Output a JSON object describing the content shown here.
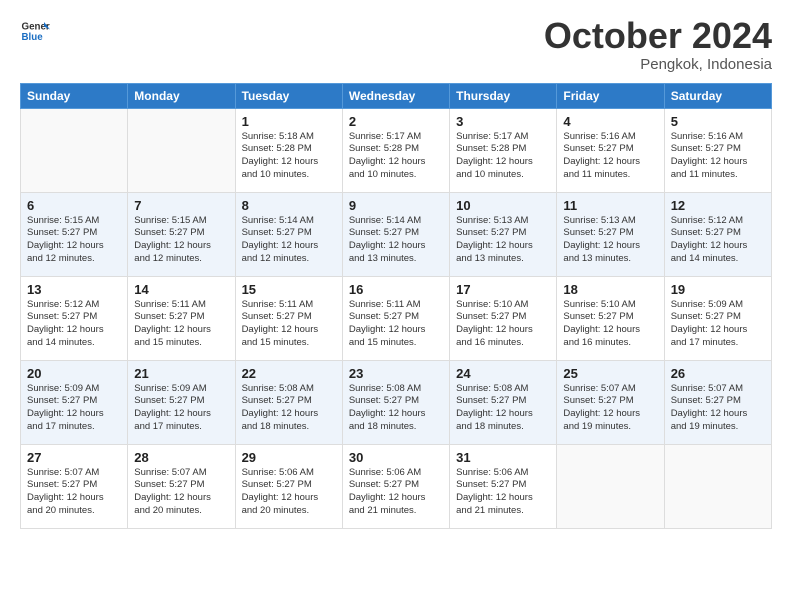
{
  "header": {
    "logo_line1": "General",
    "logo_line2": "Blue",
    "month": "October 2024",
    "location": "Pengkok, Indonesia"
  },
  "days_of_week": [
    "Sunday",
    "Monday",
    "Tuesday",
    "Wednesday",
    "Thursday",
    "Friday",
    "Saturday"
  ],
  "weeks": [
    [
      {
        "day": null,
        "info": null
      },
      {
        "day": null,
        "info": null
      },
      {
        "day": "1",
        "info": "Sunrise: 5:18 AM\nSunset: 5:28 PM\nDaylight: 12 hours\nand 10 minutes."
      },
      {
        "day": "2",
        "info": "Sunrise: 5:17 AM\nSunset: 5:28 PM\nDaylight: 12 hours\nand 10 minutes."
      },
      {
        "day": "3",
        "info": "Sunrise: 5:17 AM\nSunset: 5:28 PM\nDaylight: 12 hours\nand 10 minutes."
      },
      {
        "day": "4",
        "info": "Sunrise: 5:16 AM\nSunset: 5:27 PM\nDaylight: 12 hours\nand 11 minutes."
      },
      {
        "day": "5",
        "info": "Sunrise: 5:16 AM\nSunset: 5:27 PM\nDaylight: 12 hours\nand 11 minutes."
      }
    ],
    [
      {
        "day": "6",
        "info": "Sunrise: 5:15 AM\nSunset: 5:27 PM\nDaylight: 12 hours\nand 12 minutes."
      },
      {
        "day": "7",
        "info": "Sunrise: 5:15 AM\nSunset: 5:27 PM\nDaylight: 12 hours\nand 12 minutes."
      },
      {
        "day": "8",
        "info": "Sunrise: 5:14 AM\nSunset: 5:27 PM\nDaylight: 12 hours\nand 12 minutes."
      },
      {
        "day": "9",
        "info": "Sunrise: 5:14 AM\nSunset: 5:27 PM\nDaylight: 12 hours\nand 13 minutes."
      },
      {
        "day": "10",
        "info": "Sunrise: 5:13 AM\nSunset: 5:27 PM\nDaylight: 12 hours\nand 13 minutes."
      },
      {
        "day": "11",
        "info": "Sunrise: 5:13 AM\nSunset: 5:27 PM\nDaylight: 12 hours\nand 13 minutes."
      },
      {
        "day": "12",
        "info": "Sunrise: 5:12 AM\nSunset: 5:27 PM\nDaylight: 12 hours\nand 14 minutes."
      }
    ],
    [
      {
        "day": "13",
        "info": "Sunrise: 5:12 AM\nSunset: 5:27 PM\nDaylight: 12 hours\nand 14 minutes."
      },
      {
        "day": "14",
        "info": "Sunrise: 5:11 AM\nSunset: 5:27 PM\nDaylight: 12 hours\nand 15 minutes."
      },
      {
        "day": "15",
        "info": "Sunrise: 5:11 AM\nSunset: 5:27 PM\nDaylight: 12 hours\nand 15 minutes."
      },
      {
        "day": "16",
        "info": "Sunrise: 5:11 AM\nSunset: 5:27 PM\nDaylight: 12 hours\nand 15 minutes."
      },
      {
        "day": "17",
        "info": "Sunrise: 5:10 AM\nSunset: 5:27 PM\nDaylight: 12 hours\nand 16 minutes."
      },
      {
        "day": "18",
        "info": "Sunrise: 5:10 AM\nSunset: 5:27 PM\nDaylight: 12 hours\nand 16 minutes."
      },
      {
        "day": "19",
        "info": "Sunrise: 5:09 AM\nSunset: 5:27 PM\nDaylight: 12 hours\nand 17 minutes."
      }
    ],
    [
      {
        "day": "20",
        "info": "Sunrise: 5:09 AM\nSunset: 5:27 PM\nDaylight: 12 hours\nand 17 minutes."
      },
      {
        "day": "21",
        "info": "Sunrise: 5:09 AM\nSunset: 5:27 PM\nDaylight: 12 hours\nand 17 minutes."
      },
      {
        "day": "22",
        "info": "Sunrise: 5:08 AM\nSunset: 5:27 PM\nDaylight: 12 hours\nand 18 minutes."
      },
      {
        "day": "23",
        "info": "Sunrise: 5:08 AM\nSunset: 5:27 PM\nDaylight: 12 hours\nand 18 minutes."
      },
      {
        "day": "24",
        "info": "Sunrise: 5:08 AM\nSunset: 5:27 PM\nDaylight: 12 hours\nand 18 minutes."
      },
      {
        "day": "25",
        "info": "Sunrise: 5:07 AM\nSunset: 5:27 PM\nDaylight: 12 hours\nand 19 minutes."
      },
      {
        "day": "26",
        "info": "Sunrise: 5:07 AM\nSunset: 5:27 PM\nDaylight: 12 hours\nand 19 minutes."
      }
    ],
    [
      {
        "day": "27",
        "info": "Sunrise: 5:07 AM\nSunset: 5:27 PM\nDaylight: 12 hours\nand 20 minutes."
      },
      {
        "day": "28",
        "info": "Sunrise: 5:07 AM\nSunset: 5:27 PM\nDaylight: 12 hours\nand 20 minutes."
      },
      {
        "day": "29",
        "info": "Sunrise: 5:06 AM\nSunset: 5:27 PM\nDaylight: 12 hours\nand 20 minutes."
      },
      {
        "day": "30",
        "info": "Sunrise: 5:06 AM\nSunset: 5:27 PM\nDaylight: 12 hours\nand 21 minutes."
      },
      {
        "day": "31",
        "info": "Sunrise: 5:06 AM\nSunset: 5:27 PM\nDaylight: 12 hours\nand 21 minutes."
      },
      {
        "day": null,
        "info": null
      },
      {
        "day": null,
        "info": null
      }
    ]
  ]
}
